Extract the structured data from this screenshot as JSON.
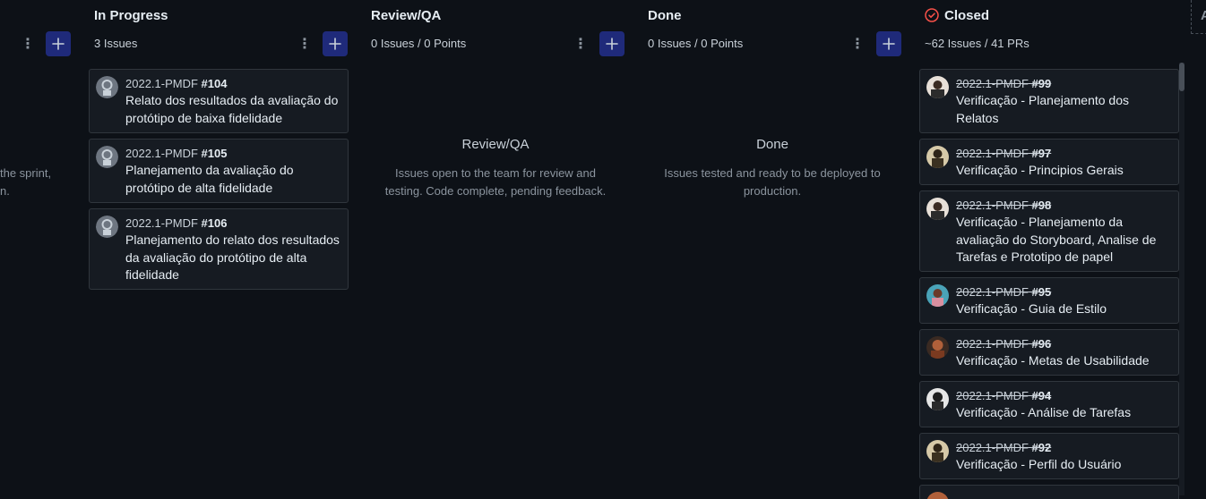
{
  "partial_column": {
    "description_lines": [
      "the sprint,",
      "n."
    ]
  },
  "columns": [
    {
      "title": "In Progress",
      "count": "3 Issues",
      "cards": [
        {
          "repo": "2022.1-PMDF",
          "number": "#104",
          "title": "Relato dos resultados da avaliação do protótipo de baixa fidelidade"
        },
        {
          "repo": "2022.1-PMDF",
          "number": "#105",
          "title": "Planejamento da avaliação do protótipo de alta fidelidade"
        },
        {
          "repo": "2022.1-PMDF",
          "number": "#106",
          "title": "Planejamento do relato dos resultados da avaliação do protótipo de alta fidelidade"
        }
      ]
    },
    {
      "title": "Review/QA",
      "count": "0 Issues / 0 Points",
      "empty_title": "Review/QA",
      "empty_desc": "Issues open to the team for review and testing. Code complete, pending feedback."
    },
    {
      "title": "Done",
      "count": "0 Issues / 0 Points",
      "empty_title": "Done",
      "empty_desc": "Issues tested and ready to be deployed to production."
    },
    {
      "title": "Closed",
      "count": "~62 Issues / 41 PRs",
      "cards": [
        {
          "repo": "2022.1-PMDF",
          "number": "#99",
          "title": "Verificação - Planejamento dos Relatos"
        },
        {
          "repo": "2022.1-PMDF",
          "number": "#97",
          "title": "Verificação - Principios Gerais"
        },
        {
          "repo": "2022.1-PMDF",
          "number": "#98",
          "title": "Verificação - Planejamento da avaliação do Storyboard, Analise de Tarefas e Prototipo de papel"
        },
        {
          "repo": "2022.1-PMDF",
          "number": "#95",
          "title": "Verificação - Guia de Estilo"
        },
        {
          "repo": "2022.1-PMDF",
          "number": "#96",
          "title": "Verificação - Metas de Usabilidade"
        },
        {
          "repo": "2022.1-PMDF",
          "number": "#94",
          "title": "Verificação - Análise de Tarefas"
        },
        {
          "repo": "2022.1-PMDF",
          "number": "#92",
          "title": "Verificação - Perfil do Usuário"
        }
      ]
    }
  ],
  "add_column_stub": "A",
  "icons": {
    "kebab": "kebab-menu-icon",
    "add": "plus-icon",
    "closed": "check-circle-icon"
  },
  "colors": {
    "background": "#0d1117",
    "card": "#161b22",
    "add_button": "#1f2a7a",
    "closed_icon": "#f85149"
  }
}
